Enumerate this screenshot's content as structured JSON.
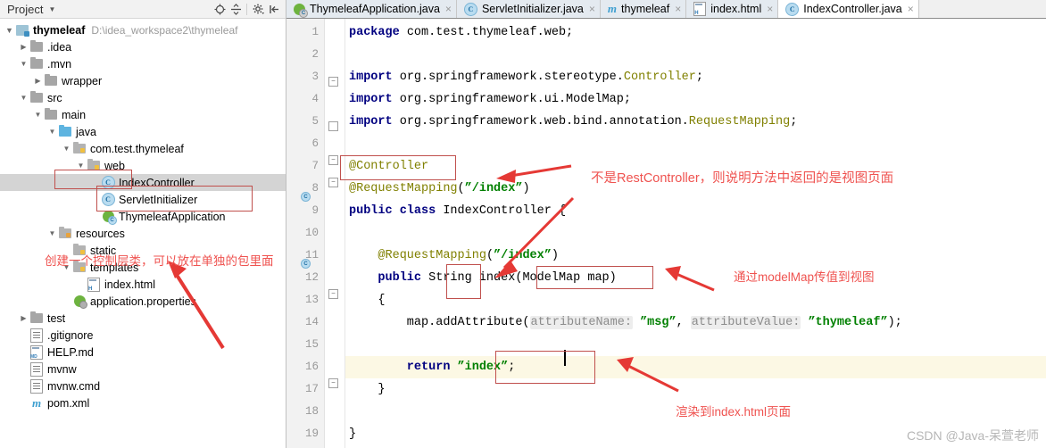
{
  "project_panel": {
    "title": "Project",
    "caret_icon": "chevron-down-icon",
    "toolbar_icons": [
      "locate-target-icon",
      "collapse-all-icon",
      "settings-gear-icon",
      "hide-panel-icon"
    ],
    "root": {
      "label": "thymeleaf",
      "path": "D:\\idea_workspace2\\thymeleaf"
    },
    "tree": [
      {
        "label": ".idea",
        "indent": 1,
        "arrow": "right",
        "icon": "folder-icon"
      },
      {
        "label": ".mvn",
        "indent": 1,
        "arrow": "down",
        "icon": "folder-icon"
      },
      {
        "label": "wrapper",
        "indent": 2,
        "arrow": "right",
        "icon": "folder-icon"
      },
      {
        "label": "src",
        "indent": 1,
        "arrow": "down",
        "icon": "folder-icon"
      },
      {
        "label": "main",
        "indent": 2,
        "arrow": "down",
        "icon": "folder-icon"
      },
      {
        "label": "java",
        "indent": 3,
        "arrow": "down",
        "icon": "source-folder-icon"
      },
      {
        "label": "com.test.thymeleaf",
        "indent": 4,
        "arrow": "down",
        "icon": "package-icon"
      },
      {
        "label": "web",
        "indent": 5,
        "arrow": "down",
        "icon": "package-icon"
      },
      {
        "label": "IndexController",
        "indent": 6,
        "arrow": "none",
        "icon": "java-class-icon",
        "selected": true
      },
      {
        "label": "ServletInitializer",
        "indent": 6,
        "arrow": "none",
        "icon": "java-class-icon"
      },
      {
        "label": "ThymeleafApplication",
        "indent": 6,
        "arrow": "none",
        "icon": "spring-boot-class-icon"
      },
      {
        "label": "resources",
        "indent": 3,
        "arrow": "down",
        "icon": "resources-folder-icon"
      },
      {
        "label": "static",
        "indent": 4,
        "arrow": "none",
        "icon": "package-icon"
      },
      {
        "label": "templates",
        "indent": 4,
        "arrow": "down",
        "icon": "package-icon"
      },
      {
        "label": "index.html",
        "indent": 5,
        "arrow": "none",
        "icon": "html-file-icon"
      },
      {
        "label": "application.properties",
        "indent": 4,
        "arrow": "none",
        "icon": "spring-properties-icon"
      },
      {
        "label": "test",
        "indent": 1,
        "arrow": "right",
        "icon": "folder-icon"
      },
      {
        "label": ".gitignore",
        "indent": 1,
        "arrow": "none",
        "icon": "text-file-icon"
      },
      {
        "label": "HELP.md",
        "indent": 1,
        "arrow": "none",
        "icon": "markdown-file-icon"
      },
      {
        "label": "mvnw",
        "indent": 1,
        "arrow": "none",
        "icon": "text-file-icon"
      },
      {
        "label": "mvnw.cmd",
        "indent": 1,
        "arrow": "none",
        "icon": "text-file-icon"
      },
      {
        "label": "pom.xml",
        "indent": 1,
        "arrow": "none",
        "icon": "maven-file-icon"
      }
    ]
  },
  "editor": {
    "tabs": [
      {
        "label": "ThymeleafApplication.java",
        "icon": "spring-boot-class-icon",
        "active": false
      },
      {
        "label": "ServletInitializer.java",
        "icon": "java-class-icon",
        "active": false
      },
      {
        "label": "thymeleaf",
        "icon": "maven-file-icon",
        "active": false
      },
      {
        "label": "index.html",
        "icon": "html-file-icon",
        "active": false
      },
      {
        "label": "IndexController.java",
        "icon": "java-class-icon",
        "active": true
      }
    ],
    "close_glyph": "×",
    "lines": [
      {
        "n": 1,
        "segments": [
          {
            "t": "package ",
            "c": "kw"
          },
          {
            "t": "com.test.thymeleaf.web;",
            "c": "plain"
          }
        ]
      },
      {
        "n": 2,
        "segments": []
      },
      {
        "n": 3,
        "segments": [
          {
            "t": "import ",
            "c": "kw"
          },
          {
            "t": "org.springframework.stereotype.",
            "c": "plain"
          },
          {
            "t": "Controller",
            "c": "ann"
          },
          {
            "t": ";",
            "c": "plain"
          }
        ]
      },
      {
        "n": 4,
        "segments": [
          {
            "t": "import ",
            "c": "kw"
          },
          {
            "t": "org.springframework.ui.ModelMap;",
            "c": "plain"
          }
        ]
      },
      {
        "n": 5,
        "segments": [
          {
            "t": "import ",
            "c": "kw"
          },
          {
            "t": "org.springframework.web.bind.annotation.",
            "c": "plain"
          },
          {
            "t": "RequestMapping",
            "c": "ann"
          },
          {
            "t": ";",
            "c": "plain"
          }
        ]
      },
      {
        "n": 6,
        "segments": []
      },
      {
        "n": 7,
        "segments": [
          {
            "t": "@Controller",
            "c": "ann"
          }
        ]
      },
      {
        "n": 8,
        "segments": [
          {
            "t": "@RequestMapping",
            "c": "ann"
          },
          {
            "t": "(",
            "c": "plain"
          },
          {
            "t": "”/index”",
            "c": "str"
          },
          {
            "t": ")",
            "c": "plain"
          }
        ]
      },
      {
        "n": 9,
        "segments": [
          {
            "t": "public class ",
            "c": "kw"
          },
          {
            "t": "IndexController {",
            "c": "plain"
          }
        ]
      },
      {
        "n": 10,
        "segments": []
      },
      {
        "n": 11,
        "segments": [
          {
            "t": "    @RequestMapping",
            "c": "ann"
          },
          {
            "t": "(",
            "c": "plain"
          },
          {
            "t": "”/index”",
            "c": "str"
          },
          {
            "t": ")",
            "c": "plain"
          }
        ]
      },
      {
        "n": 12,
        "segments": [
          {
            "t": "    public ",
            "c": "kw"
          },
          {
            "t": "String index(ModelMap map)",
            "c": "plain"
          }
        ]
      },
      {
        "n": 13,
        "segments": [
          {
            "t": "    {",
            "c": "plain"
          }
        ]
      },
      {
        "n": 14,
        "segments": [
          {
            "t": "        map.addAttribute(",
            "c": "plain"
          },
          {
            "t": "attributeName:",
            "c": "hintp"
          },
          {
            "t": " ",
            "c": "plain"
          },
          {
            "t": "”msg”",
            "c": "str"
          },
          {
            "t": ", ",
            "c": "plain"
          },
          {
            "t": "attributeValue:",
            "c": "hintp"
          },
          {
            "t": " ",
            "c": "plain"
          },
          {
            "t": "”thymeleaf”",
            "c": "str"
          },
          {
            "t": ");",
            "c": "plain"
          }
        ]
      },
      {
        "n": 15,
        "segments": []
      },
      {
        "n": 16,
        "segments": [
          {
            "t": "        return ",
            "c": "kw"
          },
          {
            "t": "”index”",
            "c": "str"
          },
          {
            "t": ";",
            "c": "plain"
          }
        ],
        "highlight": true
      },
      {
        "n": 17,
        "segments": [
          {
            "t": "    }",
            "c": "plain"
          }
        ]
      },
      {
        "n": 18,
        "segments": []
      },
      {
        "n": 19,
        "segments": [
          {
            "t": "}",
            "c": "plain"
          }
        ]
      }
    ]
  },
  "annotations": [
    {
      "id": "anno-controller",
      "text": "不是RestController，则说明方法中返回的是视图页面"
    },
    {
      "id": "anno-package",
      "text": "创建一个控制层类，可以放在单独的包里面"
    },
    {
      "id": "anno-modelmap",
      "text": "通过modelMap传值到视图"
    },
    {
      "id": "anno-render",
      "text": "渲染到index.html页面"
    }
  ],
  "watermark": "CSDN @Java-呆萱老师",
  "colors": {
    "annotation_red": "#ef5350",
    "box_red": "#c0504d",
    "keyword_blue": "#000080",
    "string_green": "#008000",
    "annotation_olive": "#808000",
    "selection_gray": "#d4d4d4",
    "line_highlight": "#fcf8e4"
  }
}
